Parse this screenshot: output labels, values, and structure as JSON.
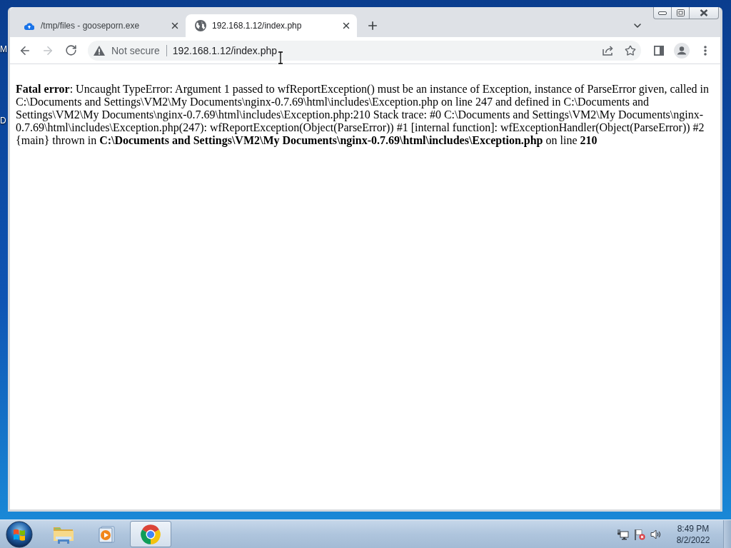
{
  "desktop": {
    "icon_labels": [
      "M",
      "D"
    ]
  },
  "window": {
    "tabs": [
      {
        "kind": "cloud",
        "title": "/tmp/files - gooseporn.exe",
        "selected": false
      },
      {
        "kind": "globe",
        "title": "192.168.1.12/index.php",
        "selected": true
      }
    ]
  },
  "navigation": [
    {
      "kind": "back",
      "disabled": false
    },
    {
      "kind": "forward",
      "disabled": true
    },
    {
      "kind": "reload",
      "disabled": false
    }
  ],
  "address_bar": {
    "security_label": "Not secure",
    "url": "192.168.1.12/index.php"
  },
  "page": {
    "message": "**Fatal error**: Uncaught TypeError: Argument 1 passed to wfReportException() must be an instance of Exception, instance of ParseError given, called in C:\\Documents and Settings\\VM2\\My Documents\\nginx-0.7.69\\html\\includes\\Exception.php on line 247 and defined in C:\\Documents and Settings\\VM2\\My Documents\\nginx-0.7.69\\html\\includes\\Exception.php:210 Stack trace: #0 C:\\Documents and Settings\\VM2\\My Documents\\nginx-0.7.69\\html\\includes\\Exception.php(247): wfReportException(Object(ParseError)) #1 [internal function]: wfExceptionHandler(Object(ParseError)) #2 {main} thrown in **C:\\Documents and Settings\\VM2\\My Documents\\nginx-0.7.69\\html\\includes\\Exception.php** on line **210**"
  },
  "taskbar": {
    "apps": [
      {
        "kind": "explorer",
        "selected": false
      },
      {
        "kind": "media",
        "selected": false
      },
      {
        "kind": "chrome",
        "selected": true
      }
    ],
    "clock": {
      "time": "8:49 PM",
      "date": "8/2/2022"
    }
  }
}
